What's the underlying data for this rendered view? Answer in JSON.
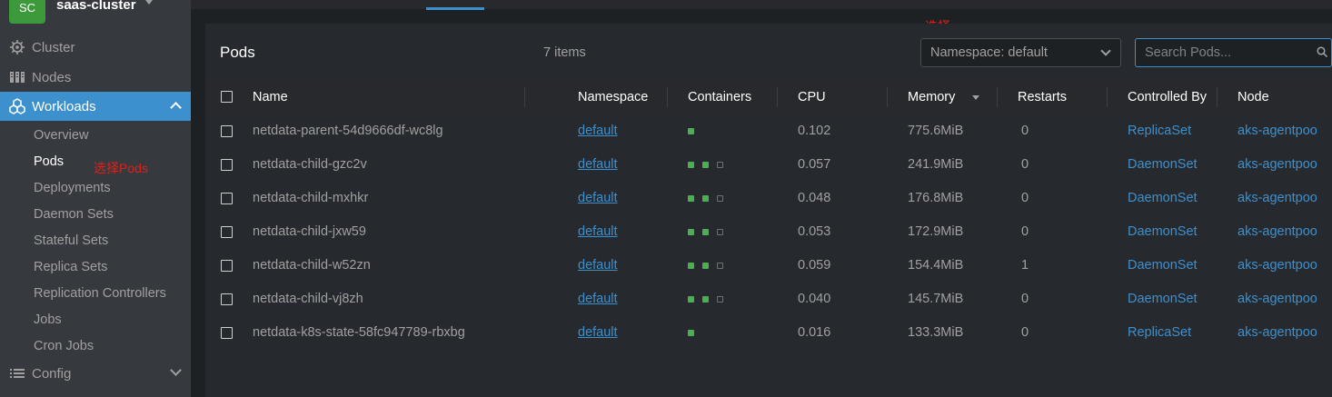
{
  "sidebar": {
    "cluster": {
      "avatar": "SC",
      "name": "saas-cluster"
    },
    "items": [
      {
        "label": "Cluster",
        "icon": "helm-icon"
      },
      {
        "label": "Nodes",
        "icon": "nodes-icon"
      },
      {
        "label": "Workloads",
        "icon": "workloads-icon",
        "active": true
      },
      {
        "label": "Config",
        "icon": "list-icon"
      }
    ],
    "workload_items": [
      "Overview",
      "Pods",
      "Deployments",
      "Daemon Sets",
      "Stateful Sets",
      "Replica Sets",
      "Replication Controllers",
      "Jobs",
      "Cron Jobs"
    ],
    "annotation_pods": "选择Pods"
  },
  "main": {
    "title": "Pods",
    "items_count": "7 items",
    "annotation_namespace": "选择namespace",
    "namespace_select": "Namespace: default",
    "search_placeholder": "Search Pods...",
    "columns": [
      "Name",
      "Namespace",
      "Containers",
      "CPU",
      "Memory",
      "Restarts",
      "Controlled By",
      "Node"
    ],
    "rows": [
      {
        "name": "netdata-parent-54d9666df-wc8lg",
        "namespace": "default",
        "containers": [
          "running"
        ],
        "cpu": "0.102",
        "memory": "775.6MiB",
        "restarts": "0",
        "controlled_by": "ReplicaSet",
        "node": "aks-agentpoo"
      },
      {
        "name": "netdata-child-gzc2v",
        "namespace": "default",
        "containers": [
          "running",
          "running",
          "waiting"
        ],
        "cpu": "0.057",
        "memory": "241.9MiB",
        "restarts": "0",
        "controlled_by": "DaemonSet",
        "node": "aks-agentpoo"
      },
      {
        "name": "netdata-child-mxhkr",
        "namespace": "default",
        "containers": [
          "running",
          "running",
          "waiting"
        ],
        "cpu": "0.048",
        "memory": "176.8MiB",
        "restarts": "0",
        "controlled_by": "DaemonSet",
        "node": "aks-agentpoo"
      },
      {
        "name": "netdata-child-jxw59",
        "namespace": "default",
        "containers": [
          "running",
          "running",
          "waiting"
        ],
        "cpu": "0.053",
        "memory": "172.9MiB",
        "restarts": "0",
        "controlled_by": "DaemonSet",
        "node": "aks-agentpoo"
      },
      {
        "name": "netdata-child-w52zn",
        "namespace": "default",
        "containers": [
          "running",
          "running",
          "waiting"
        ],
        "cpu": "0.059",
        "memory": "154.4MiB",
        "restarts": "1",
        "controlled_by": "DaemonSet",
        "node": "aks-agentpoo"
      },
      {
        "name": "netdata-child-vj8zh",
        "namespace": "default",
        "containers": [
          "running",
          "running",
          "waiting"
        ],
        "cpu": "0.040",
        "memory": "145.7MiB",
        "restarts": "0",
        "controlled_by": "DaemonSet",
        "node": "aks-agentpoo"
      },
      {
        "name": "netdata-k8s-state-58fc947789-rbxbg",
        "namespace": "default",
        "containers": [
          "running"
        ],
        "cpu": "0.016",
        "memory": "133.3MiB",
        "restarts": "0",
        "controlled_by": "ReplicaSet",
        "node": "aks-agentpoo"
      }
    ]
  },
  "colors": {
    "accent": "#3d90ce",
    "running": "#4caf50",
    "annotation": "#e0201a",
    "sidebar_bg": "#36393e"
  }
}
